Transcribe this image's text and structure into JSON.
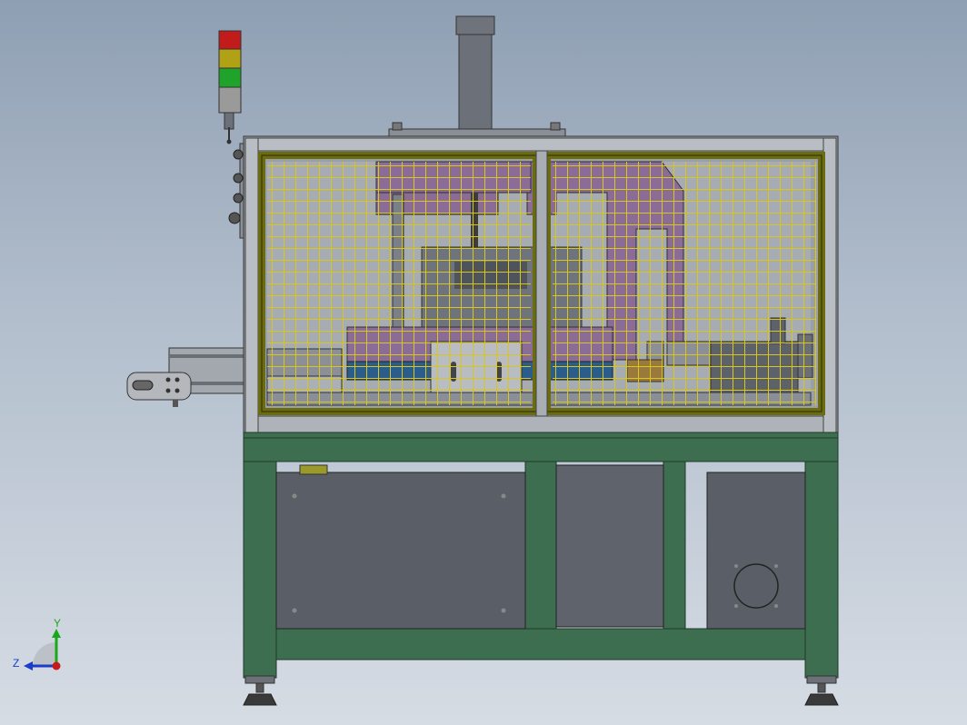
{
  "viewport": {
    "background_top": "#8f9fb3",
    "background_bottom": "#d6dce4"
  },
  "model": {
    "frame_color": "#3e6e50",
    "panel_color": "#5a5e66",
    "cage_frame_color": "#6b6b10",
    "mesh_color": "#d4c21a",
    "fixture_color": "#8a6c96",
    "profile_color": "#9aa0a6",
    "signal_tower": {
      "lights": [
        "red",
        "yellow",
        "green",
        "grey"
      ],
      "colors": [
        "#c21b1b",
        "#b0a214",
        "#1fa32a",
        "#9a9a9a"
      ]
    }
  },
  "triad": {
    "y_label": "Y",
    "z_label": "Z",
    "y_color": "#1aa81a",
    "z_color": "#1a3cc8",
    "x_color": "#c81a1a"
  }
}
